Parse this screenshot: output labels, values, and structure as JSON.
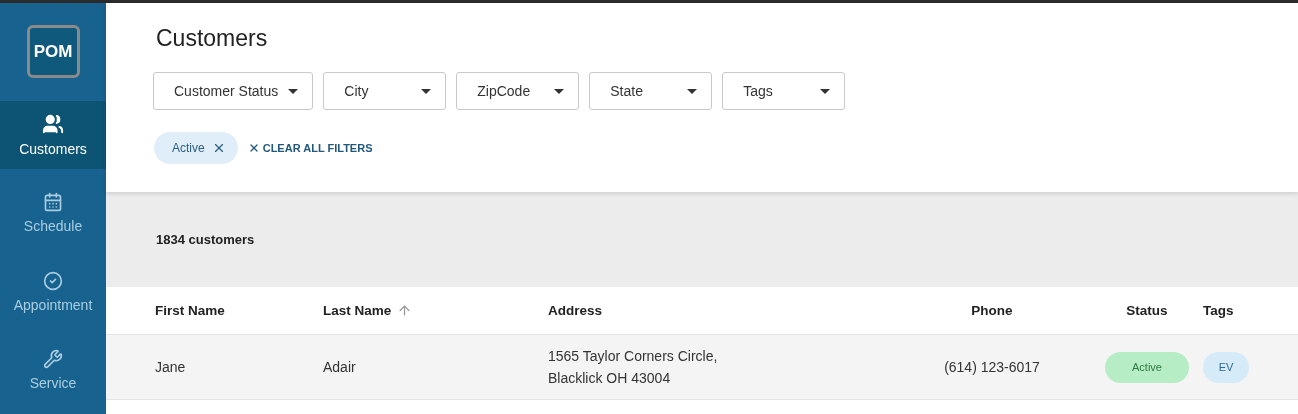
{
  "logo": {
    "text": "POM"
  },
  "nav": [
    {
      "label": "Customers",
      "selected": true
    },
    {
      "label": "Schedule",
      "selected": false
    },
    {
      "label": "Appointment",
      "selected": false
    },
    {
      "label": "Service",
      "selected": false
    }
  ],
  "title": "Customers",
  "filters": [
    {
      "label": "Customer Status"
    },
    {
      "label": "City"
    },
    {
      "label": "ZipCode"
    },
    {
      "label": "State"
    },
    {
      "label": "Tags"
    }
  ],
  "active_filters": [
    {
      "label": "Active"
    }
  ],
  "clear_filters": "CLEAR ALL FILTERS",
  "count": "1834 customers",
  "table": {
    "columns": [
      {
        "label": "First Name",
        "sorted": false
      },
      {
        "label": "Last Name",
        "sorted": true
      },
      {
        "label": "Address",
        "sorted": false
      },
      {
        "label": "Phone",
        "sorted": false
      },
      {
        "label": "Status",
        "sorted": false
      },
      {
        "label": "Tags",
        "sorted": false
      }
    ],
    "rows": [
      {
        "first_name": "Jane",
        "last_name": "Adair",
        "address": [
          "1565 Taylor Corners Circle,",
          "Blacklick OH 43004"
        ],
        "phone": "(614) 123-6017",
        "status": "Active",
        "tags": [
          "EV"
        ]
      }
    ]
  }
}
